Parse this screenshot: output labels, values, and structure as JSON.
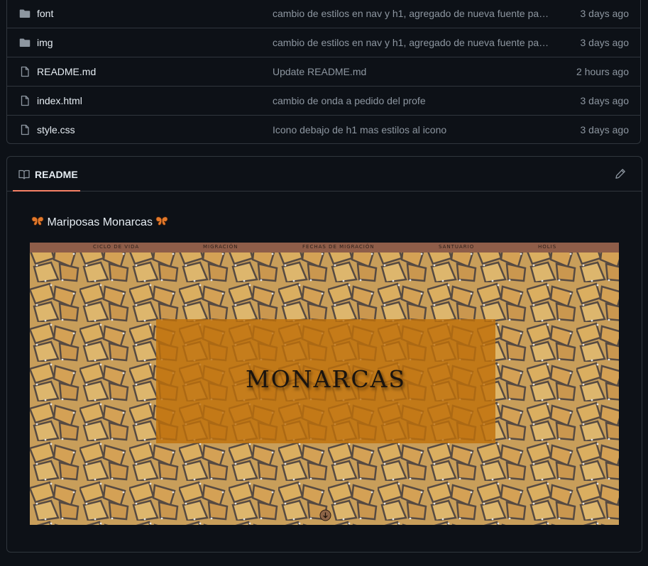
{
  "files": [
    {
      "name": "font",
      "type": "folder",
      "message": "cambio de estilos en nav y h1, agregado de nueva fuente pa…",
      "time": "3 days ago"
    },
    {
      "name": "img",
      "type": "folder",
      "message": "cambio de estilos en nav y h1, agregado de nueva fuente pa…",
      "time": "3 days ago"
    },
    {
      "name": "README.md",
      "type": "file",
      "message": "Update README.md",
      "time": "2 hours ago"
    },
    {
      "name": "index.html",
      "type": "file",
      "message": "cambio de onda a pedido del profe",
      "time": "3 days ago"
    },
    {
      "name": "style.css",
      "type": "file",
      "message": "Icono debajo de h1 mas estilos al icono",
      "time": "3 days ago"
    }
  ],
  "readme": {
    "tab_label": "README",
    "heading": "Mariposas Monarcas",
    "preview": {
      "nav": [
        "CICLO DE VIDA",
        "MIGRACIÓN",
        "FECHAS DE MIGRACIÓN",
        "SANTUARIO",
        "HOLIS"
      ],
      "title": "MONARCAS"
    }
  },
  "icons": {
    "folder": "folder-icon",
    "file": "file-icon",
    "book": "book-icon",
    "edit": "pencil-icon",
    "butterfly": "butterfly-icon",
    "scroll": "arrow-down-circle-icon"
  },
  "colors": {
    "background": "#0d1117",
    "border": "#30363d",
    "muted_text": "#8d96a0",
    "tab_underline": "#f78166",
    "nav_bar": "#8e5d49",
    "hero_box": "#bf700a"
  }
}
